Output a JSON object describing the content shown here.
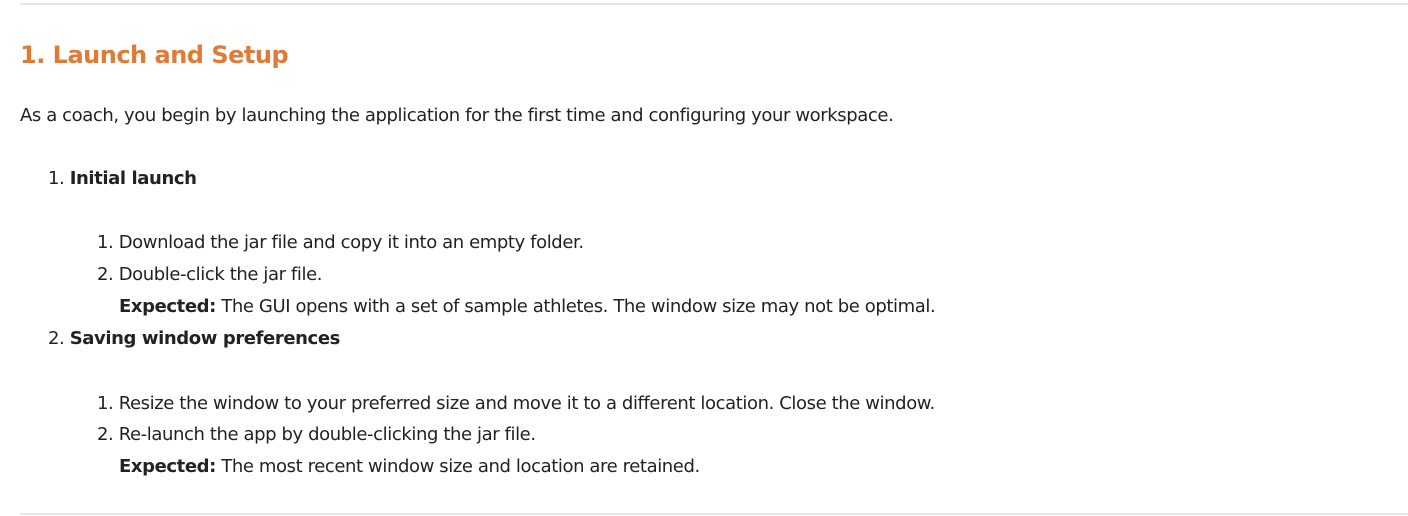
{
  "section": {
    "heading": "1. Launch and Setup",
    "intro": "As a coach, you begin by launching the application for the first time and configuring your workspace.",
    "heading_color": "#e07a35",
    "steps": [
      {
        "number": "1.",
        "title": "Initial launch",
        "substeps": [
          {
            "number": "1.",
            "text": "Download the jar file and copy it into an empty folder."
          },
          {
            "number": "2.",
            "text": "Double-click the jar file.",
            "expected_label": "Expected:",
            "expected": "The GUI opens with a set of sample athletes. The window size may not be optimal."
          }
        ]
      },
      {
        "number": "2.",
        "title": "Saving window preferences",
        "substeps": [
          {
            "number": "1.",
            "text": "Resize the window to your preferred size and move it to a different location. Close the window."
          },
          {
            "number": "2.",
            "text": "Re-launch the app by double-clicking the jar file.",
            "expected_label": "Expected:",
            "expected": "The most recent window size and location are retained."
          }
        ]
      }
    ]
  }
}
